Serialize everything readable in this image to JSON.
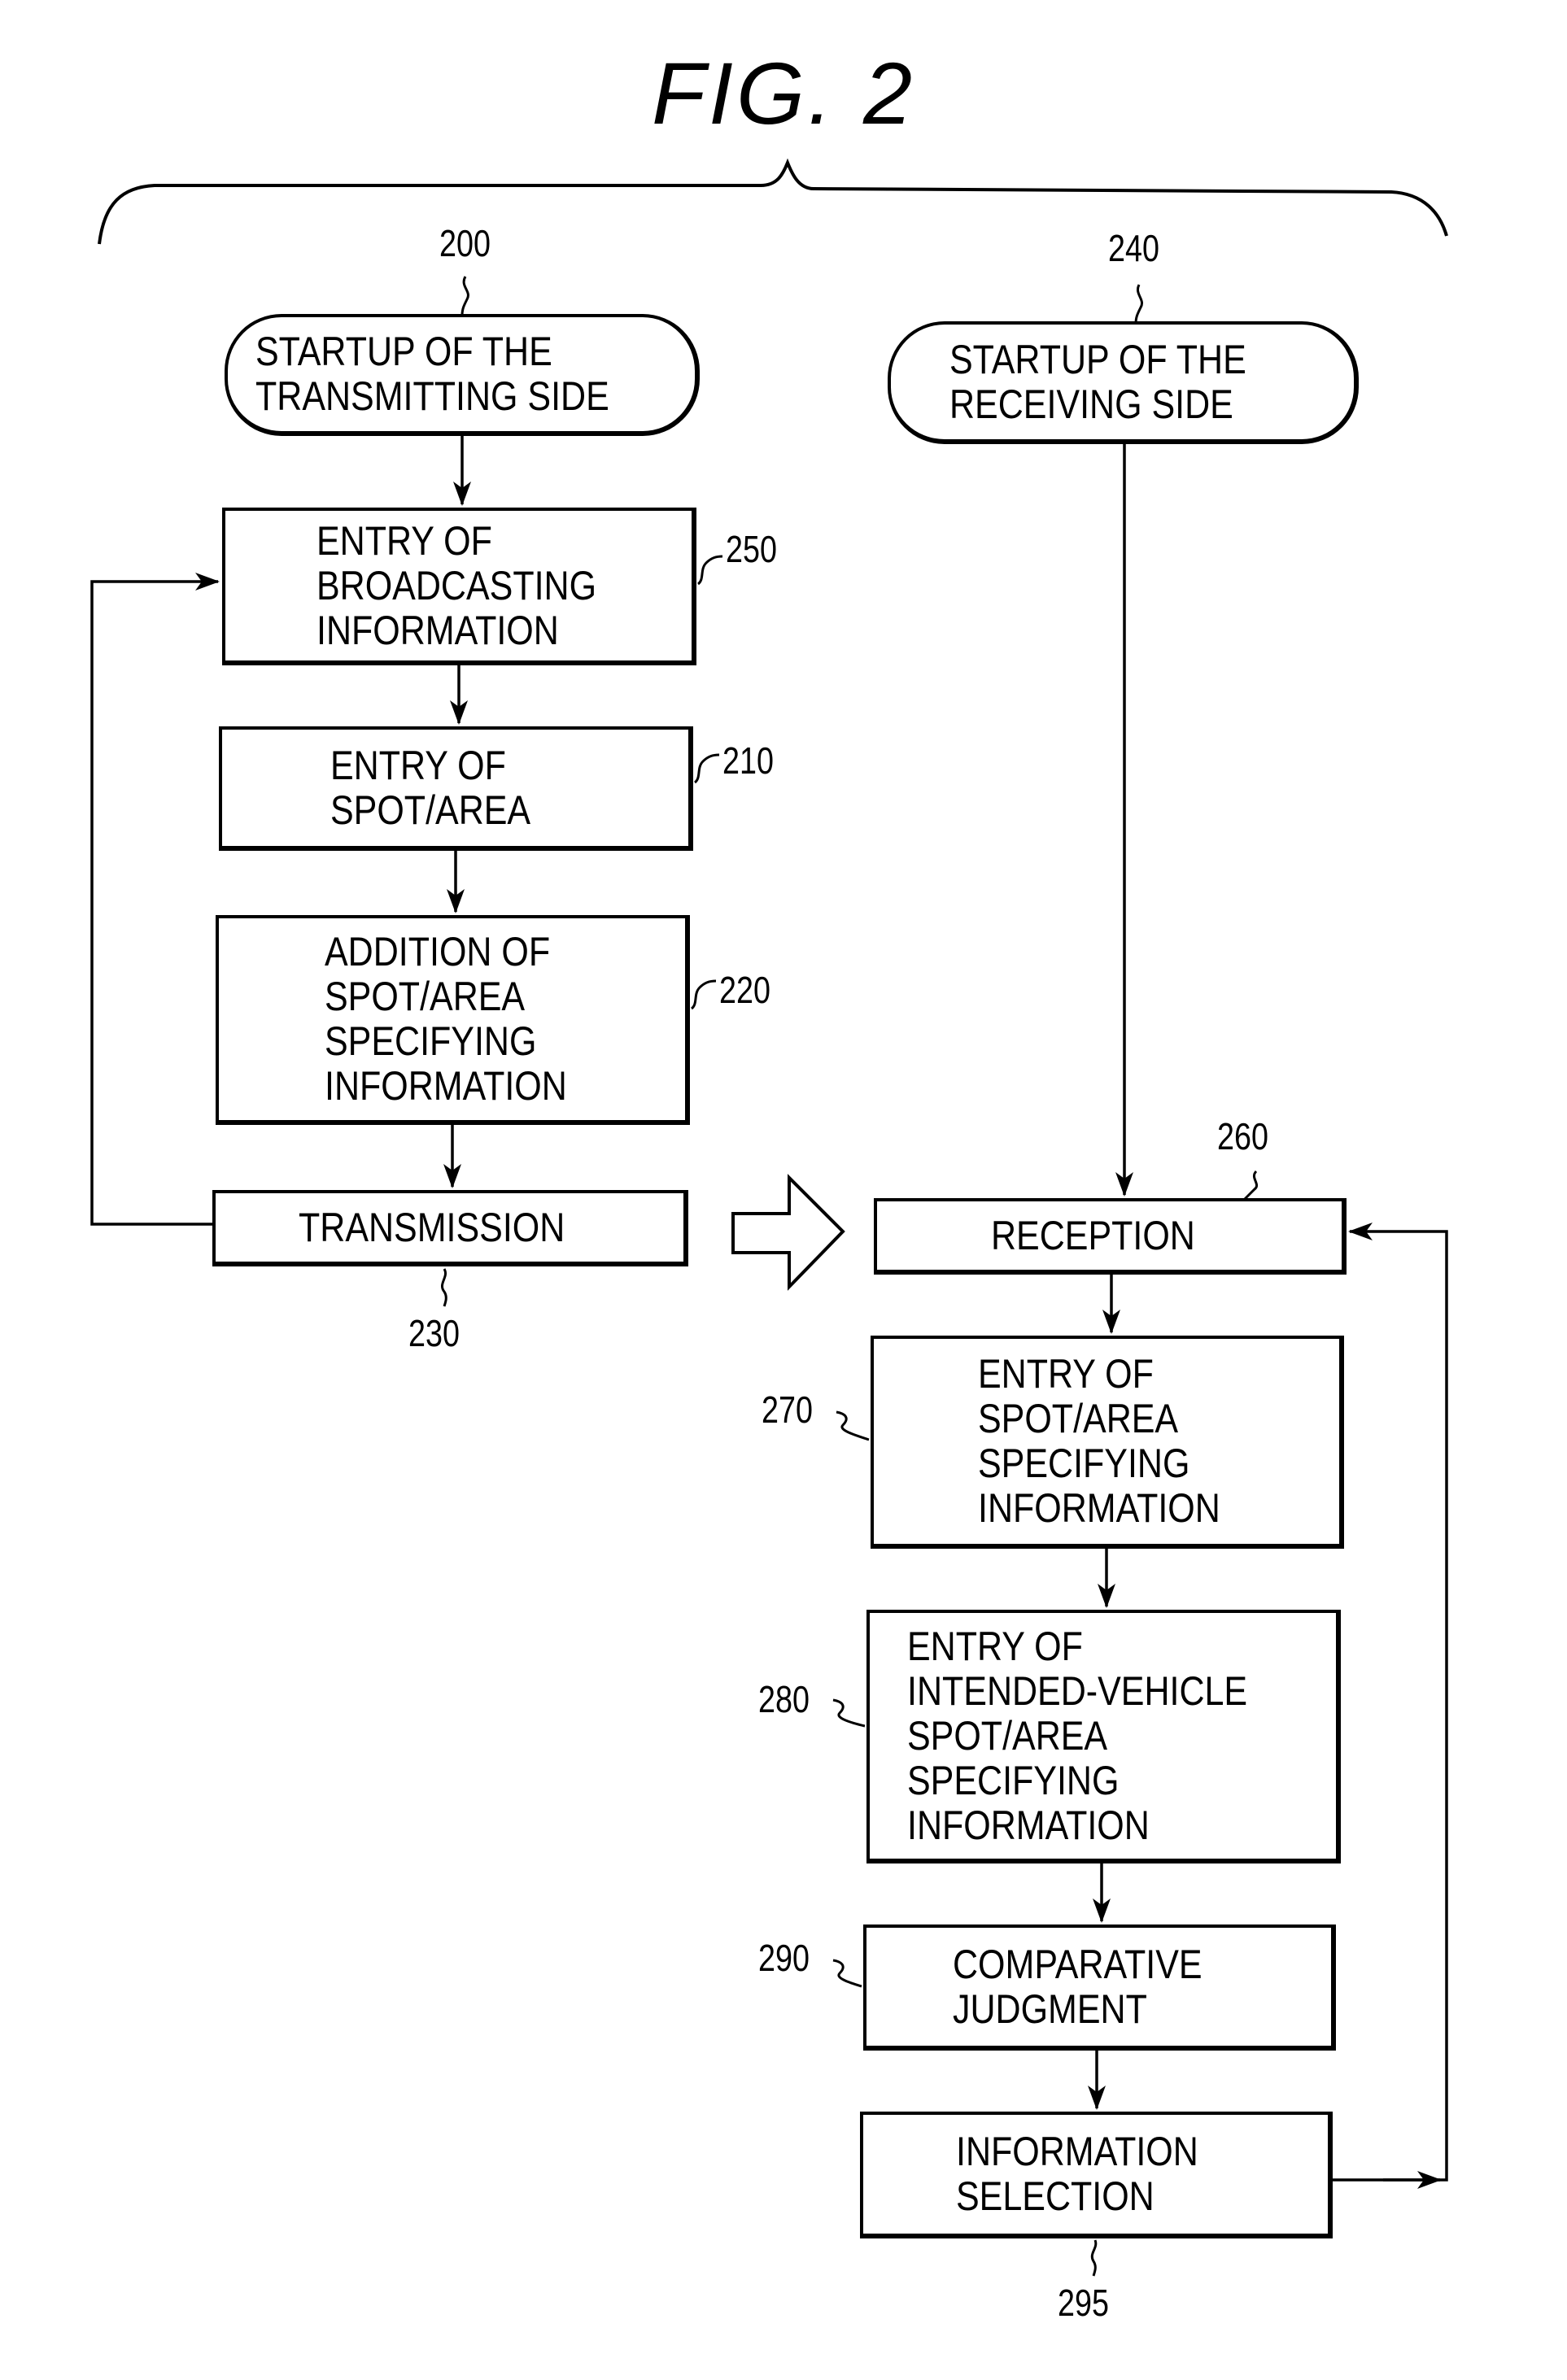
{
  "figure": {
    "title": "FIG. 2"
  },
  "transmitting_side": {
    "start": {
      "ref": "200",
      "label_line1": "STARTUP OF THE",
      "label_line2": "TRANSMITTING SIDE"
    },
    "steps": [
      {
        "ref": "250",
        "lines": [
          "ENTRY OF",
          "BROADCASTING",
          "INFORMATION"
        ]
      },
      {
        "ref": "210",
        "lines": [
          "ENTRY OF",
          "SPOT/AREA"
        ]
      },
      {
        "ref": "220",
        "lines": [
          "ADDITION OF",
          "SPOT/AREA",
          "SPECIFYING",
          "INFORMATION"
        ]
      },
      {
        "ref": "230",
        "lines": [
          "TRANSMISSION"
        ]
      }
    ]
  },
  "receiving_side": {
    "start": {
      "ref": "240",
      "label_line1": "STARTUP OF THE",
      "label_line2": "RECEIVING SIDE"
    },
    "steps": [
      {
        "ref": "260",
        "lines": [
          "RECEPTION"
        ]
      },
      {
        "ref": "270",
        "lines": [
          "ENTRY OF",
          "SPOT/AREA",
          "SPECIFYING",
          "INFORMATION"
        ]
      },
      {
        "ref": "280",
        "lines": [
          "ENTRY OF",
          "INTENDED-VEHICLE",
          "SPOT/AREA",
          "SPECIFYING",
          "INFORMATION"
        ]
      },
      {
        "ref": "290",
        "lines": [
          "COMPARATIVE",
          "JUDGMENT"
        ]
      },
      {
        "ref": "295",
        "lines": [
          "INFORMATION",
          "SELECTION"
        ]
      }
    ]
  },
  "connections": [
    {
      "from": "200",
      "to": "250"
    },
    {
      "from": "250",
      "to": "210"
    },
    {
      "from": "210",
      "to": "220"
    },
    {
      "from": "220",
      "to": "230"
    },
    {
      "from": "230",
      "to": "250",
      "type": "loop-back"
    },
    {
      "from": "230",
      "to": "260",
      "type": "hollow-transfer-arrow"
    },
    {
      "from": "240",
      "to": "260"
    },
    {
      "from": "260",
      "to": "270"
    },
    {
      "from": "270",
      "to": "280"
    },
    {
      "from": "280",
      "to": "290"
    },
    {
      "from": "290",
      "to": "295"
    },
    {
      "from": "295",
      "to": "260",
      "type": "loop-back"
    }
  ]
}
